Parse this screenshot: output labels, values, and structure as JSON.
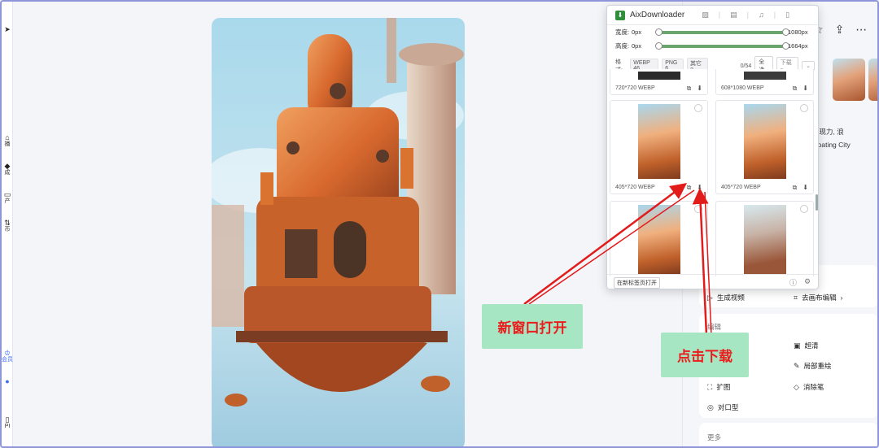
{
  "left_rail": {
    "items": [
      {
        "label": "播",
        "icon": "home-icon"
      },
      {
        "label": "成",
        "icon": "diamond-icon"
      },
      {
        "label": "产",
        "icon": "folder-icon"
      },
      {
        "label": "币",
        "icon": "swap-icon"
      }
    ],
    "member_label": "会员",
    "api_label": "PI"
  },
  "extension": {
    "name": "AixDownloader",
    "tabs": [
      "image-tab",
      "video-tab",
      "audio-tab",
      "doc-tab"
    ],
    "width_label": "宽度:",
    "width_min": "0px",
    "width_max": "1080px",
    "width_value_fraction": 1.0,
    "height_label": "高度:",
    "height_min": "0px",
    "height_max": "1664px",
    "height_value_fraction": 1.0,
    "format_label": "格式:",
    "formats": [
      "WEBP 46",
      "PNG 6",
      "其它 2"
    ],
    "count": "0/54",
    "select_all": "全选",
    "download": "下载",
    "cells": [
      {
        "meta": "720*720   WEBP"
      },
      {
        "meta": "608*1080   WEBP"
      },
      {
        "meta": "405*720   WEBP"
      },
      {
        "meta": "405*720   WEBP"
      },
      {
        "meta": ""
      },
      {
        "meta": ""
      }
    ],
    "open_new_tab": "在新标签页打开"
  },
  "right_panel": {
    "desc_line1": "极致表现力, 浪",
    "desc_line2": "nge Floating City",
    "gen_video": "生成视频",
    "canvas_edit": "去画布编辑",
    "edit_header": "编辑",
    "hd": "超清",
    "redraw": "局部重绘",
    "expand": "扩图",
    "eraser": "消除笔",
    "lip_sync": "对口型",
    "more": "更多"
  },
  "callouts": {
    "new_window": "新窗口打开",
    "click_download": "点击下载"
  },
  "colors": {
    "callout_bg": "#a7e6c2",
    "callout_text": "#ea1c1c",
    "arrow": "#e21b1b",
    "slider": "#6aa56e"
  }
}
